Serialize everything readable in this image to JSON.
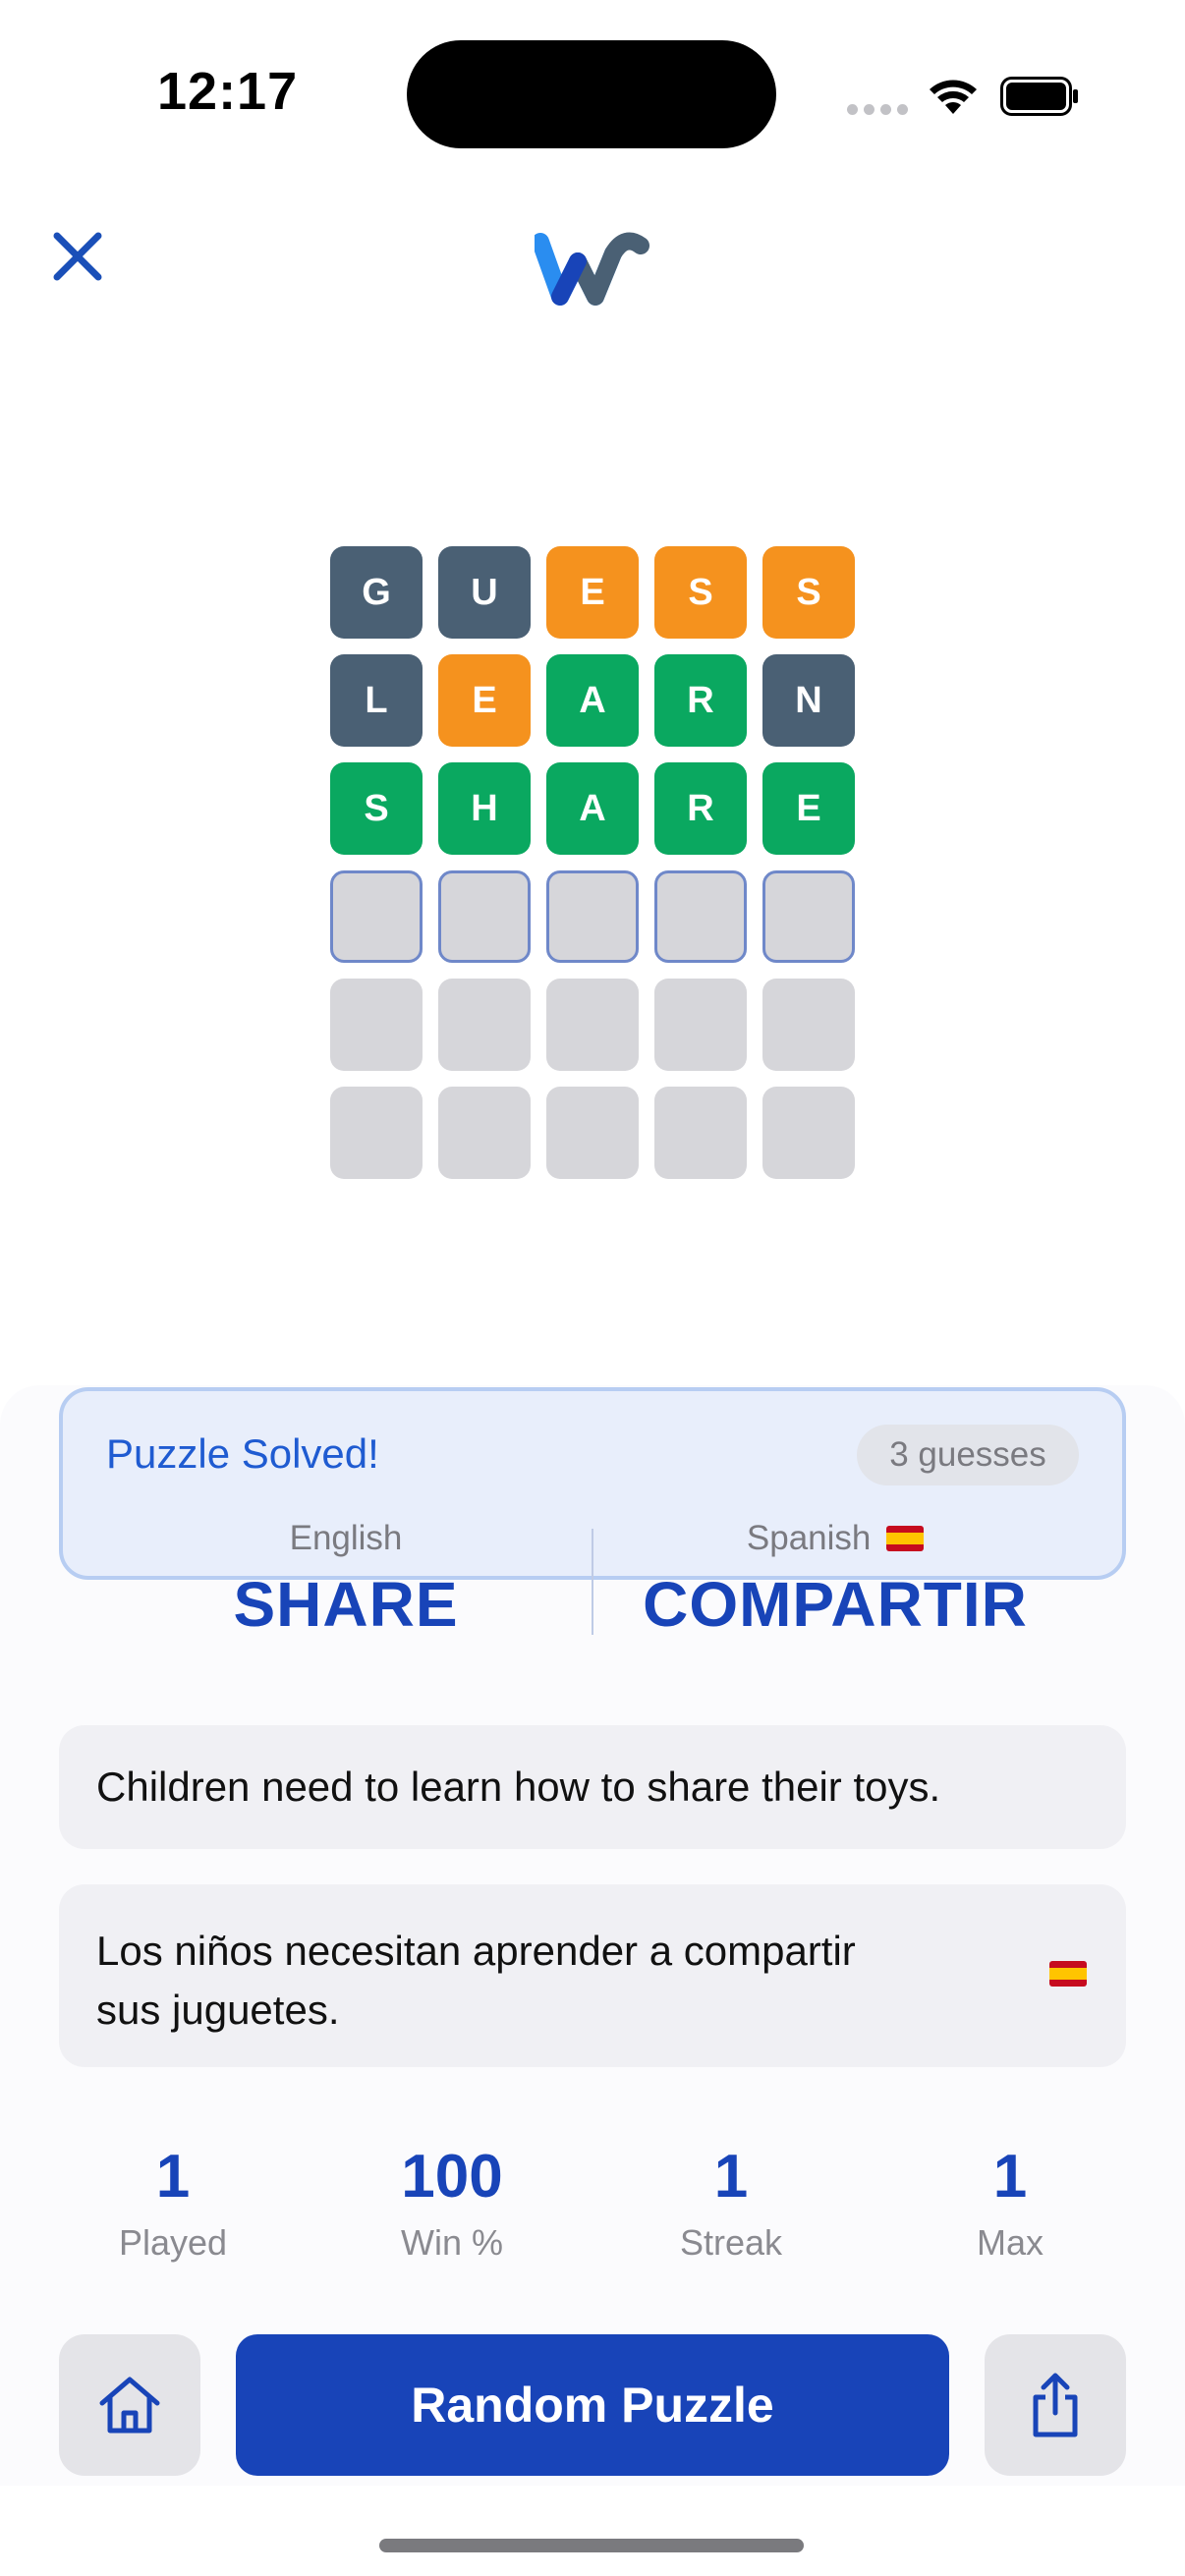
{
  "status_bar": {
    "time": "12:17"
  },
  "header": {
    "close_icon": "close-icon",
    "logo_icon": "w-logo-icon"
  },
  "grid": {
    "rows": [
      [
        {
          "letter": "G",
          "state": "absent"
        },
        {
          "letter": "U",
          "state": "absent"
        },
        {
          "letter": "E",
          "state": "present"
        },
        {
          "letter": "S",
          "state": "present"
        },
        {
          "letter": "S",
          "state": "present"
        }
      ],
      [
        {
          "letter": "L",
          "state": "absent"
        },
        {
          "letter": "E",
          "state": "present"
        },
        {
          "letter": "A",
          "state": "correct"
        },
        {
          "letter": "R",
          "state": "correct"
        },
        {
          "letter": "N",
          "state": "absent"
        }
      ],
      [
        {
          "letter": "S",
          "state": "correct"
        },
        {
          "letter": "H",
          "state": "correct"
        },
        {
          "letter": "A",
          "state": "correct"
        },
        {
          "letter": "R",
          "state": "correct"
        },
        {
          "letter": "E",
          "state": "correct"
        }
      ],
      [
        {
          "letter": "",
          "state": "active"
        },
        {
          "letter": "",
          "state": "active"
        },
        {
          "letter": "",
          "state": "active"
        },
        {
          "letter": "",
          "state": "active"
        },
        {
          "letter": "",
          "state": "active"
        }
      ],
      [
        {
          "letter": "",
          "state": "empty"
        },
        {
          "letter": "",
          "state": "empty"
        },
        {
          "letter": "",
          "state": "empty"
        },
        {
          "letter": "",
          "state": "empty"
        },
        {
          "letter": "",
          "state": "empty"
        }
      ],
      [
        {
          "letter": "",
          "state": "empty"
        },
        {
          "letter": "",
          "state": "empty"
        },
        {
          "letter": "",
          "state": "empty"
        },
        {
          "letter": "",
          "state": "empty"
        },
        {
          "letter": "",
          "state": "empty"
        }
      ]
    ],
    "colors": {
      "absent": "#4a6074",
      "present": "#f5921e",
      "correct": "#0aa860",
      "empty": "#d6d6da"
    }
  },
  "result": {
    "title": "Puzzle Solved!",
    "guesses": "3 guesses",
    "source_language": "English",
    "source_word": "SHARE",
    "target_language": "Spanish",
    "target_flag_icon": "spain-flag-icon",
    "target_word": "COMPARTIR"
  },
  "sentences": {
    "english": "Children need to learn how to share their toys.",
    "spanish_line1": "Los niños necesitan aprender a compartir",
    "spanish_line2": "sus juguetes.",
    "spanish_flag_icon": "spain-flag-icon"
  },
  "stats": [
    {
      "value": "1",
      "label": "Played"
    },
    {
      "value": "100",
      "label": "Win %"
    },
    {
      "value": "1",
      "label": "Streak"
    },
    {
      "value": "1",
      "label": "Max"
    }
  ],
  "actions": {
    "home_icon": "home-icon",
    "random_label": "Random Puzzle",
    "share_icon": "share-icon"
  },
  "accent_color": "#1844b8"
}
